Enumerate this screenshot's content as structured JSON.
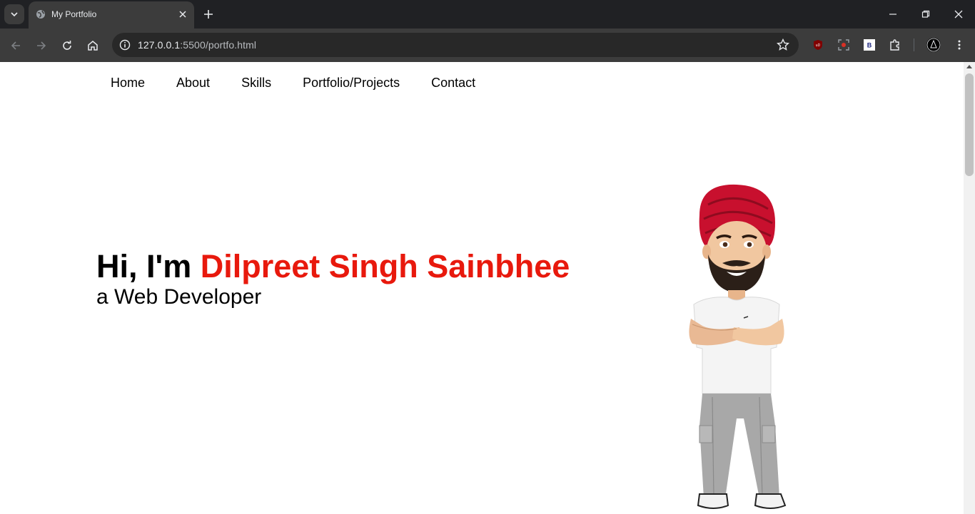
{
  "browser": {
    "tab_title": "My Portfolio",
    "url_host": "127.0.0.1",
    "url_path": ":5500/portfo.html",
    "extensions": [
      "ublock-icon",
      "screen-capture-icon",
      "b-extension-icon",
      "extensions-puzzle-icon"
    ]
  },
  "nav": {
    "items": [
      "Home",
      "About",
      "Skills",
      "Portfolio/Projects",
      "Contact"
    ]
  },
  "hero": {
    "greeting": "Hi, I'm ",
    "name": "Dilpreet Singh Sainbhee",
    "subtitle": "a Web Developer"
  },
  "colors": {
    "accent": "#e8190d"
  }
}
